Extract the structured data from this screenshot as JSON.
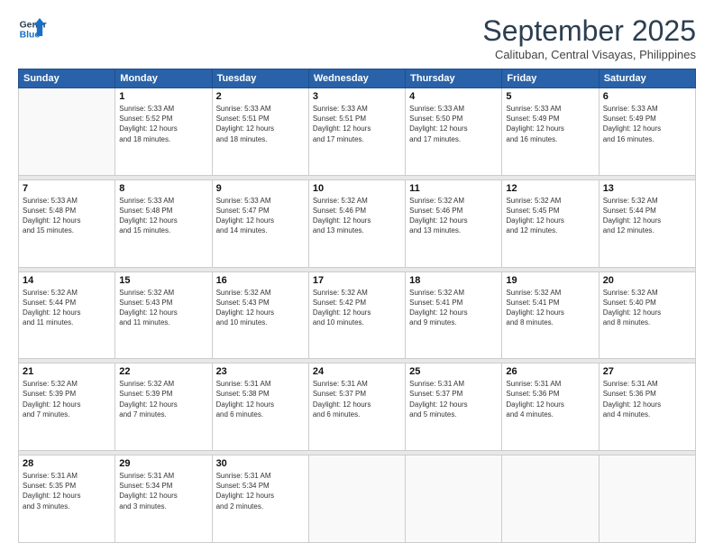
{
  "header": {
    "logo_line1": "General",
    "logo_line2": "Blue",
    "month_title": "September 2025",
    "location": "Calituban, Central Visayas, Philippines"
  },
  "weekdays": [
    "Sunday",
    "Monday",
    "Tuesday",
    "Wednesday",
    "Thursday",
    "Friday",
    "Saturday"
  ],
  "weeks": [
    [
      {
        "day": "",
        "info": ""
      },
      {
        "day": "1",
        "info": "Sunrise: 5:33 AM\nSunset: 5:52 PM\nDaylight: 12 hours\nand 18 minutes."
      },
      {
        "day": "2",
        "info": "Sunrise: 5:33 AM\nSunset: 5:51 PM\nDaylight: 12 hours\nand 18 minutes."
      },
      {
        "day": "3",
        "info": "Sunrise: 5:33 AM\nSunset: 5:51 PM\nDaylight: 12 hours\nand 17 minutes."
      },
      {
        "day": "4",
        "info": "Sunrise: 5:33 AM\nSunset: 5:50 PM\nDaylight: 12 hours\nand 17 minutes."
      },
      {
        "day": "5",
        "info": "Sunrise: 5:33 AM\nSunset: 5:49 PM\nDaylight: 12 hours\nand 16 minutes."
      },
      {
        "day": "6",
        "info": "Sunrise: 5:33 AM\nSunset: 5:49 PM\nDaylight: 12 hours\nand 16 minutes."
      }
    ],
    [
      {
        "day": "7",
        "info": "Sunrise: 5:33 AM\nSunset: 5:48 PM\nDaylight: 12 hours\nand 15 minutes."
      },
      {
        "day": "8",
        "info": "Sunrise: 5:33 AM\nSunset: 5:48 PM\nDaylight: 12 hours\nand 15 minutes."
      },
      {
        "day": "9",
        "info": "Sunrise: 5:33 AM\nSunset: 5:47 PM\nDaylight: 12 hours\nand 14 minutes."
      },
      {
        "day": "10",
        "info": "Sunrise: 5:32 AM\nSunset: 5:46 PM\nDaylight: 12 hours\nand 13 minutes."
      },
      {
        "day": "11",
        "info": "Sunrise: 5:32 AM\nSunset: 5:46 PM\nDaylight: 12 hours\nand 13 minutes."
      },
      {
        "day": "12",
        "info": "Sunrise: 5:32 AM\nSunset: 5:45 PM\nDaylight: 12 hours\nand 12 minutes."
      },
      {
        "day": "13",
        "info": "Sunrise: 5:32 AM\nSunset: 5:44 PM\nDaylight: 12 hours\nand 12 minutes."
      }
    ],
    [
      {
        "day": "14",
        "info": "Sunrise: 5:32 AM\nSunset: 5:44 PM\nDaylight: 12 hours\nand 11 minutes."
      },
      {
        "day": "15",
        "info": "Sunrise: 5:32 AM\nSunset: 5:43 PM\nDaylight: 12 hours\nand 11 minutes."
      },
      {
        "day": "16",
        "info": "Sunrise: 5:32 AM\nSunset: 5:43 PM\nDaylight: 12 hours\nand 10 minutes."
      },
      {
        "day": "17",
        "info": "Sunrise: 5:32 AM\nSunset: 5:42 PM\nDaylight: 12 hours\nand 10 minutes."
      },
      {
        "day": "18",
        "info": "Sunrise: 5:32 AM\nSunset: 5:41 PM\nDaylight: 12 hours\nand 9 minutes."
      },
      {
        "day": "19",
        "info": "Sunrise: 5:32 AM\nSunset: 5:41 PM\nDaylight: 12 hours\nand 8 minutes."
      },
      {
        "day": "20",
        "info": "Sunrise: 5:32 AM\nSunset: 5:40 PM\nDaylight: 12 hours\nand 8 minutes."
      }
    ],
    [
      {
        "day": "21",
        "info": "Sunrise: 5:32 AM\nSunset: 5:39 PM\nDaylight: 12 hours\nand 7 minutes."
      },
      {
        "day": "22",
        "info": "Sunrise: 5:32 AM\nSunset: 5:39 PM\nDaylight: 12 hours\nand 7 minutes."
      },
      {
        "day": "23",
        "info": "Sunrise: 5:31 AM\nSunset: 5:38 PM\nDaylight: 12 hours\nand 6 minutes."
      },
      {
        "day": "24",
        "info": "Sunrise: 5:31 AM\nSunset: 5:37 PM\nDaylight: 12 hours\nand 6 minutes."
      },
      {
        "day": "25",
        "info": "Sunrise: 5:31 AM\nSunset: 5:37 PM\nDaylight: 12 hours\nand 5 minutes."
      },
      {
        "day": "26",
        "info": "Sunrise: 5:31 AM\nSunset: 5:36 PM\nDaylight: 12 hours\nand 4 minutes."
      },
      {
        "day": "27",
        "info": "Sunrise: 5:31 AM\nSunset: 5:36 PM\nDaylight: 12 hours\nand 4 minutes."
      }
    ],
    [
      {
        "day": "28",
        "info": "Sunrise: 5:31 AM\nSunset: 5:35 PM\nDaylight: 12 hours\nand 3 minutes."
      },
      {
        "day": "29",
        "info": "Sunrise: 5:31 AM\nSunset: 5:34 PM\nDaylight: 12 hours\nand 3 minutes."
      },
      {
        "day": "30",
        "info": "Sunrise: 5:31 AM\nSunset: 5:34 PM\nDaylight: 12 hours\nand 2 minutes."
      },
      {
        "day": "",
        "info": ""
      },
      {
        "day": "",
        "info": ""
      },
      {
        "day": "",
        "info": ""
      },
      {
        "day": "",
        "info": ""
      }
    ]
  ]
}
